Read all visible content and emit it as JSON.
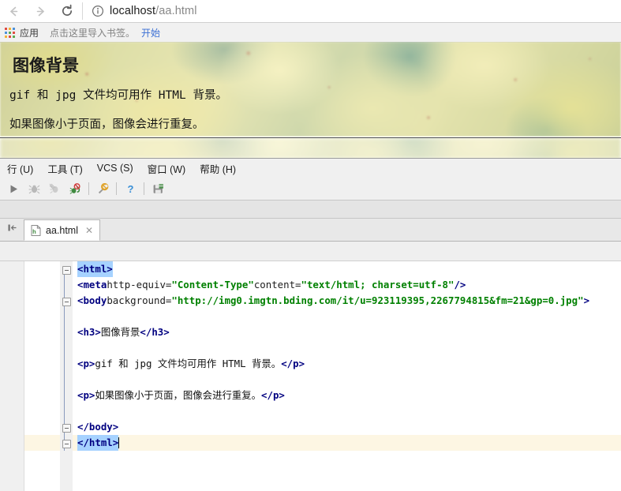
{
  "browser": {
    "back_icon": "arrow-left-icon",
    "forward_icon": "arrow-right-icon",
    "reload_icon": "reload-icon",
    "info_icon": "info-circle-icon",
    "url_host": "localhost",
    "url_path": "/aa.html",
    "url_full": "localhost/aa.html",
    "bookmarks": {
      "apps_icon": "apps-grid-icon",
      "apps_label": "应用",
      "import_hint": "点击这里导入书签。",
      "start_link": "开始"
    }
  },
  "page": {
    "heading": "图像背景",
    "paragraph1": "gif 和 jpg 文件均可用作 HTML 背景。",
    "paragraph2": "如果图像小于页面，图像会进行重复。"
  },
  "ide": {
    "menu": [
      {
        "label": "行 (U)",
        "mnemonic": "U"
      },
      {
        "label": "工具 (T)",
        "mnemonic": "T"
      },
      {
        "label": "VCS (S)",
        "mnemonic": "S"
      },
      {
        "label": "窗口 (W)",
        "mnemonic": "W"
      },
      {
        "label": "帮助 (H)",
        "mnemonic": "H"
      }
    ],
    "toolbar": [
      {
        "name": "run-icon",
        "title": "运行"
      },
      {
        "name": "debug-icon",
        "title": "调试"
      },
      {
        "name": "coverage-icon",
        "title": "覆盖率"
      },
      {
        "name": "stop-debug-icon",
        "title": "停止"
      },
      {
        "name": "settings-wrench-icon",
        "title": "设置"
      },
      {
        "name": "help-icon",
        "title": "帮助"
      },
      {
        "name": "save-icon",
        "title": "保存"
      }
    ],
    "tab": {
      "hide_icon": "hide-panel-icon",
      "file_icon": "html-file-icon",
      "label": "aa.html",
      "close_icon": "close-icon"
    },
    "editor": {
      "lines": [
        {
          "id": "line-html-open",
          "fold": true,
          "selected": true,
          "segments": [
            {
              "type": "tag",
              "text": "<html>"
            }
          ]
        },
        {
          "id": "line-meta",
          "fold": false,
          "segments": [
            {
              "type": "tag",
              "text": "<meta"
            },
            {
              "type": "attr",
              "text": " http-equiv="
            },
            {
              "type": "val",
              "text": "\"Content-Type\""
            },
            {
              "type": "attr",
              "text": " content="
            },
            {
              "type": "val",
              "text": "\"text/html; charset=utf-8\""
            },
            {
              "type": "tag",
              "text": " />"
            }
          ]
        },
        {
          "id": "line-body-open",
          "fold": true,
          "segments": [
            {
              "type": "tag",
              "text": "<body"
            },
            {
              "type": "attr",
              "text": " background="
            },
            {
              "type": "val",
              "text": "\"http://img0.imgtn.bding.com/it/u=923119395,2267794815&fm=21&gp=0.jpg\""
            },
            {
              "type": "tag",
              "text": ">"
            }
          ]
        },
        {
          "id": "line-blank-1",
          "fold": false,
          "segments": []
        },
        {
          "id": "line-h3",
          "fold": false,
          "segments": [
            {
              "type": "tag",
              "text": "<h3>"
            },
            {
              "type": "txt",
              "text": "图像背景"
            },
            {
              "type": "tag",
              "text": "</h3>"
            }
          ]
        },
        {
          "id": "line-blank-2",
          "fold": false,
          "segments": []
        },
        {
          "id": "line-p1",
          "fold": false,
          "segments": [
            {
              "type": "tag",
              "text": "<p>"
            },
            {
              "type": "txt",
              "text": "gif 和 jpg 文件均可用作 HTML 背景。"
            },
            {
              "type": "tag",
              "text": "</p>"
            }
          ]
        },
        {
          "id": "line-blank-3",
          "fold": false,
          "segments": []
        },
        {
          "id": "line-p2",
          "fold": false,
          "segments": [
            {
              "type": "tag",
              "text": "<p>"
            },
            {
              "type": "txt",
              "text": "如果图像小于页面，图像会进行重复。"
            },
            {
              "type": "tag",
              "text": "</p>"
            }
          ]
        },
        {
          "id": "line-blank-4",
          "fold": false,
          "segments": []
        },
        {
          "id": "line-body-close",
          "fold": true,
          "segments": [
            {
              "type": "tag",
              "text": "</body>"
            }
          ]
        },
        {
          "id": "line-html-close",
          "fold": true,
          "selected": true,
          "caret": true,
          "caretline": true,
          "segments": [
            {
              "type": "tag",
              "text": "</html>"
            }
          ]
        }
      ]
    }
  },
  "colors": {
    "tag_blue": "#000080",
    "string_green": "#008000",
    "selection_blue": "#a6d2ff",
    "caretline_cream": "#fdf6e3",
    "link_blue": "#3b6fd4",
    "ide_bg": "#f0f0f0"
  }
}
